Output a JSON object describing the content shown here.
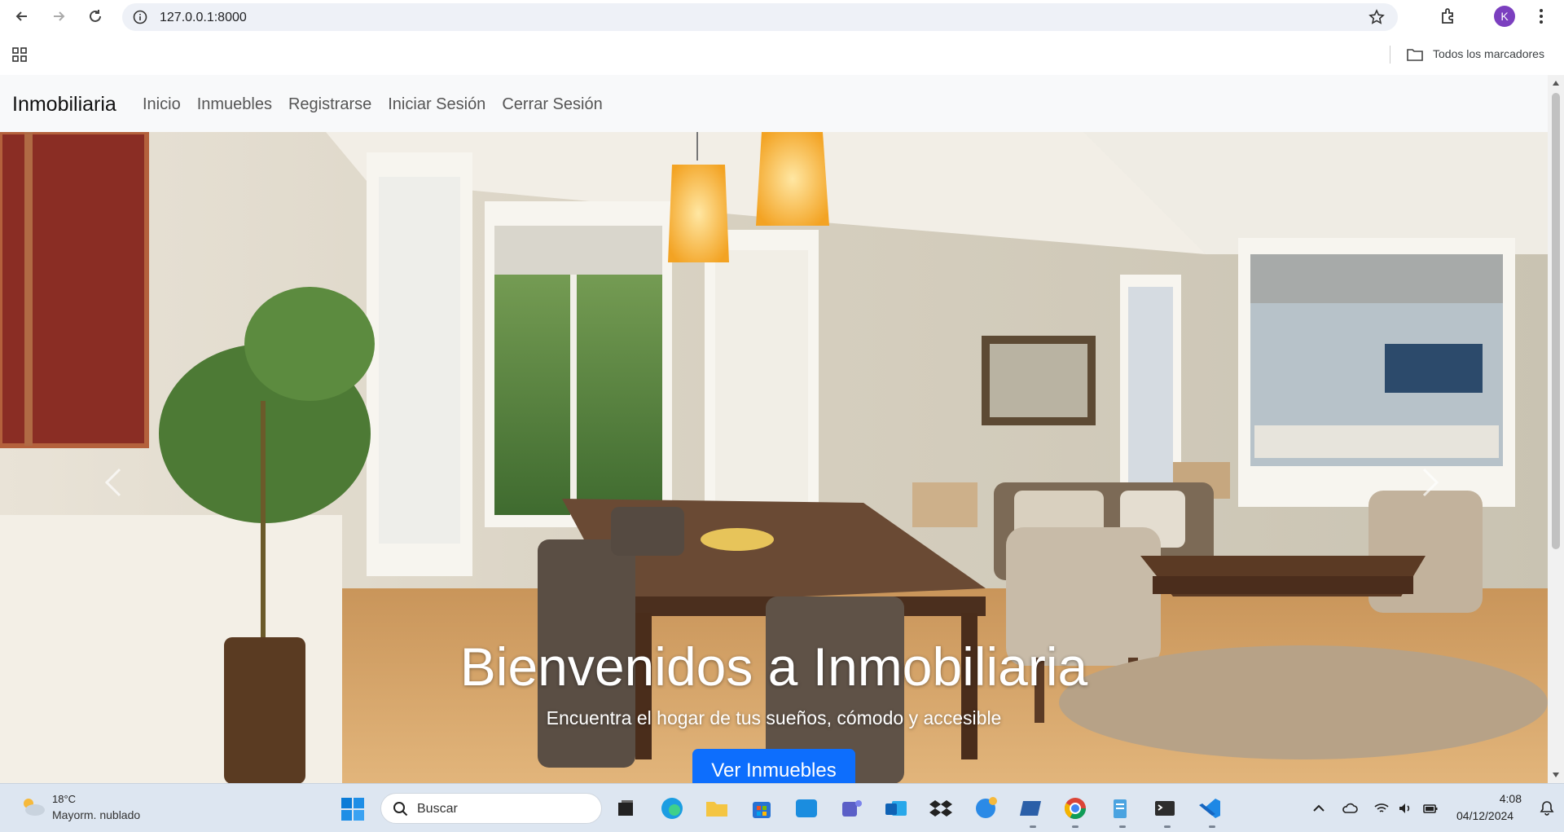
{
  "browser": {
    "url": "127.0.0.1:8000",
    "profile_initial": "K",
    "bookmarks_folder_label": "Todos los marcadores"
  },
  "site": {
    "brand": "Inmobiliaria",
    "nav": [
      "Inicio",
      "Inmuebles",
      "Registrarse",
      "Iniciar Sesión",
      "Cerrar Sesión"
    ]
  },
  "hero": {
    "title": "Bienvenidos a Inmobiliaria",
    "subtitle": "Encuentra el hogar de tus sueños, cómodo y accesible",
    "cta_label": "Ver Inmuebles"
  },
  "taskbar": {
    "weather_temp": "18°C",
    "weather_desc": "Mayorm. nublado",
    "search_label": "Buscar",
    "time": "4:08",
    "date": "04/12/2024"
  },
  "colors": {
    "primary_button": "#0d6efd",
    "navbar_bg": "#f8f9fa",
    "avatar": "#7b3fbf"
  }
}
